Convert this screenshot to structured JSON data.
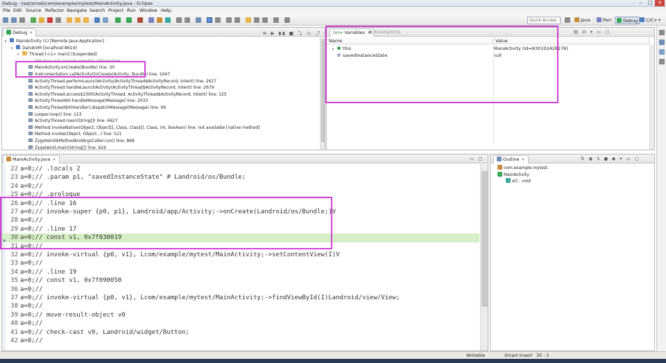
{
  "window": {
    "title": "Debug - test/smali/com/example/mytest/MainActivity.java - Eclipse",
    "min": "–",
    "max": "□",
    "close": "✕"
  },
  "menu": [
    "File",
    "Edit",
    "Source",
    "Refactor",
    "Navigate",
    "Search",
    "Project",
    "Run",
    "Window",
    "Help"
  ],
  "toolbar": {
    "quick_access_placeholder": "Quick Access",
    "perspectives": [
      "Java",
      "Perl",
      "Debug",
      "C/C++"
    ],
    "active_perspective": "Debug"
  },
  "debug_view": {
    "tab_label": "Debug",
    "tree": [
      {
        "indent": 0,
        "icon": "launch-icon",
        "text": "MainActivity (1) [Remote Java Application]"
      },
      {
        "indent": 1,
        "icon": "vm-icon",
        "text": "DalvikVM [localhost:8614]"
      },
      {
        "indent": 2,
        "icon": "thread-icon",
        "text": "Thread [<1> main] (Suspended)"
      },
      {
        "indent": 3,
        "icon": "info-icon",
        "text": "VM does not provide monitor information"
      },
      {
        "indent": 3,
        "icon": "frame-icon",
        "text": "MainActivity.onCreate(Bundle) line: 30"
      },
      {
        "indent": 3,
        "icon": "frame-icon",
        "text": "Instrumentation.callActivityOnCreate(Activity, Bundle) line: 1047"
      },
      {
        "indent": 3,
        "icon": "frame-icon",
        "text": "ActivityThread.performLaunchActivity(ActivityThread$ActivityRecord, Intent) line: 2627"
      },
      {
        "indent": 3,
        "icon": "frame-icon",
        "text": "ActivityThread.handleLaunchActivity(ActivityThread$ActivityRecord, Intent) line: 2679"
      },
      {
        "indent": 3,
        "icon": "frame-icon",
        "text": "ActivityThread.access$2300(ActivityThread, ActivityThread$ActivityRecord, Intent) line: 125"
      },
      {
        "indent": 3,
        "icon": "frame-icon",
        "text": "ActivityThread$H.handleMessage(Message) line: 2033"
      },
      {
        "indent": 3,
        "icon": "frame-icon",
        "text": "ActivityThread$H(Handler).dispatchMessage(Message) line: 99"
      },
      {
        "indent": 3,
        "icon": "frame-icon",
        "text": "Looper.loop() line: 123"
      },
      {
        "indent": 3,
        "icon": "frame-icon",
        "text": "ActivityThread.main(String[]) line: 4627"
      },
      {
        "indent": 3,
        "icon": "frame-icon",
        "text": "Method.invokeNative(Object, Object[], Class, Class[], Class, int, boolean) line: not available [native method]"
      },
      {
        "indent": 3,
        "icon": "frame-icon",
        "text": "Method.invoke(Object, Object...) line: 521"
      },
      {
        "indent": 3,
        "icon": "frame-icon",
        "text": "ZygoteInit$MethodAndArgsCaller.run() line: 868"
      },
      {
        "indent": 3,
        "icon": "frame-icon",
        "text": "ZygoteInit.main(String[]) line: 626"
      }
    ]
  },
  "variables_view": {
    "tabs": [
      "Variables",
      "Breakpoints"
    ],
    "columns": [
      "Name",
      "Value"
    ],
    "rows": [
      {
        "name": "this",
        "value": "MainActivity  (id=830102428176)",
        "expandable": true
      },
      {
        "name": "savedInstanceState",
        "value": "null",
        "expandable": false
      }
    ]
  },
  "editor": {
    "tab_label": "MainActivity.java",
    "current_line": 30,
    "lines": [
      {
        "n": "22",
        "text": "a=0;//      .locals 2"
      },
      {
        "n": "23",
        "text": "a=0;//      .param p1, \"savedInstanceState\"    # Landroid/os/Bundle;"
      },
      {
        "n": "24",
        "text": "a=0;//"
      },
      {
        "n": "25",
        "text": "a=0;//      .prologue"
      },
      {
        "n": "26",
        "text": "a=0;//      .line 16"
      },
      {
        "n": "27",
        "text": "a=0;//      invoke-super {p0, p1}, Landroid/app/Activity;->onCreate(Landroid/os/Bundle;)V"
      },
      {
        "n": "28",
        "text": "a=0;//"
      },
      {
        "n": "29",
        "text": "a=0;//      .line 17"
      },
      {
        "n": "30",
        "text": "a=0;//      const v1, 0x7f030019"
      },
      {
        "n": "31",
        "text": "a=0;//"
      },
      {
        "n": "32",
        "text": "a=0;//      invoke-virtual {p0, v1}, Lcom/example/mytest/MainActivity;->setContentView(I)V"
      },
      {
        "n": "33",
        "text": "a=0;//"
      },
      {
        "n": "34",
        "text": "a=0;//      .line 19"
      },
      {
        "n": "35",
        "text": "a=0;//      const v1, 0x7f090050"
      },
      {
        "n": "36",
        "text": "a=0;//"
      },
      {
        "n": "37",
        "text": "a=0;//      invoke-virtual {p0, v1}, Lcom/example/mytest/MainActivity;->findViewById(I)Landroid/view/View;"
      },
      {
        "n": "38",
        "text": "a=0;//"
      },
      {
        "n": "39",
        "text": "a=0;//      move-result-object v0"
      },
      {
        "n": "40",
        "text": "a=0;//"
      },
      {
        "n": "41",
        "text": "a=0;//      check-cast v0, Landroid/widget/Button;"
      },
      {
        "n": "42",
        "text": "a=0;//"
      }
    ]
  },
  "outline_view": {
    "tab_label": "Outline",
    "items": [
      {
        "indent": 0,
        "text": "com.example.mytest"
      },
      {
        "indent": 0,
        "text": "MainActivity"
      },
      {
        "indent": 1,
        "text": "a() : void"
      }
    ]
  },
  "status": {
    "mode": "Writable",
    "insert": "Smart Insert",
    "position": "30 : 1"
  },
  "colors": {
    "highlight_box": "#d23fd8",
    "current_line": "#d6efc6"
  }
}
